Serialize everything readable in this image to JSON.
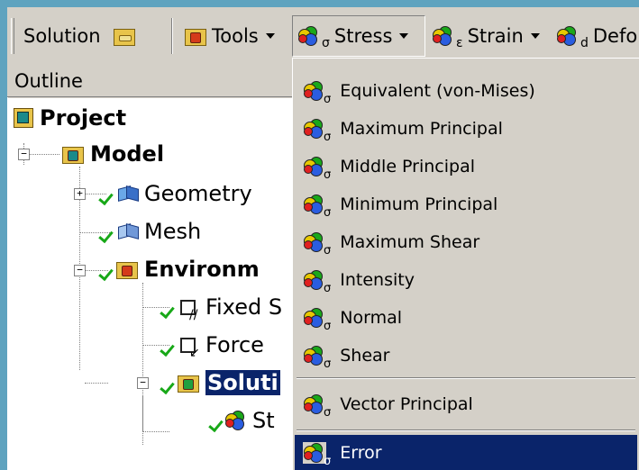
{
  "toolbar": {
    "solution_label": "Solution",
    "tools_label": "Tools",
    "stress_label": "Stress",
    "stress_sub": "σ",
    "strain_label": "Strain",
    "strain_sub": "ε",
    "deformation_label": "Defor",
    "deformation_sub": "d"
  },
  "outline": {
    "header": "Outline",
    "nodes": {
      "project": "Project",
      "model": "Model",
      "geometry": "Geometry",
      "mesh": "Mesh",
      "environment": "Environm",
      "fixed_support": "Fixed S",
      "force": "Force",
      "solution": "Soluti",
      "solution_child": "St"
    },
    "selected_node": "solution"
  },
  "stress_menu": {
    "sub": "σ",
    "items": [
      "Equivalent (von-Mises)",
      "Maximum Principal",
      "Middle Principal",
      "Minimum Principal",
      "Maximum Shear",
      "Intensity",
      "Normal",
      "Shear",
      "Vector Principal",
      "Error"
    ],
    "highlighted_index": 9
  },
  "colors": {
    "highlight": "#0a246a",
    "face": "#d4d0c8",
    "desktop": "#5fa3bf",
    "check": "#18a818"
  },
  "icons": {
    "results": "rainbow-result-icon",
    "folder": "folder-icon",
    "project": "project-icon",
    "geometry": "cube-icon",
    "check": "checkmark-icon"
  }
}
